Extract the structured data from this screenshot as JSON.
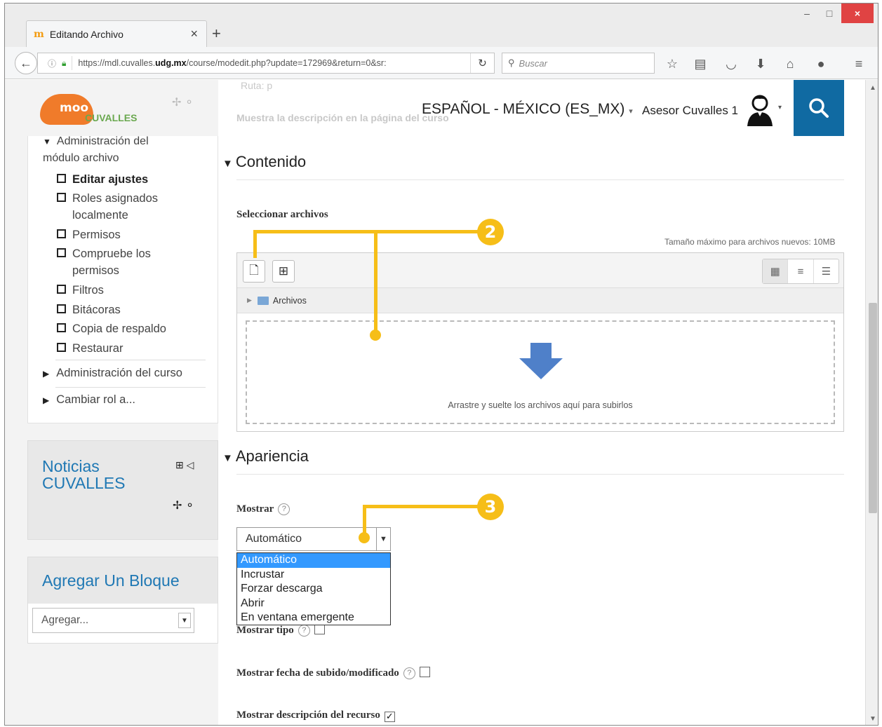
{
  "browser": {
    "tab_title": "Editando Archivo",
    "tab_favicon": "m",
    "tab_close": "×",
    "new_tab": "+",
    "window_controls": {
      "minimize": "–",
      "maximize": "□",
      "close": "×"
    },
    "url_prefix": "https://mdl.cuvalles.",
    "url_domain": "udg.mx",
    "url_path": "/course/modedit.php?update=172969&return=0&sr:",
    "search_placeholder": "Buscar",
    "toolbar_icons": [
      "star-icon",
      "reading-list-icon",
      "pocket-icon",
      "download-icon",
      "home-icon",
      "chat-icon",
      "menu-icon"
    ]
  },
  "header": {
    "logo_text": "moo",
    "logo_brand": "CUVALLES",
    "language": "ESPAÑOL - MÉXICO (ES_MX)",
    "user_name": "Asesor Cuvalles 1",
    "faded_path_text": "Ruta: p",
    "faded_description_text": "Muestra la descripción en la página del curso"
  },
  "sidebar": {
    "admin_heading": "Administración del módulo archivo",
    "items": [
      {
        "label": "Editar ajustes",
        "bold": true
      },
      {
        "label": "Roles asignados localmente"
      },
      {
        "label": "Permisos"
      },
      {
        "label": "Compruebe los permisos"
      },
      {
        "label": "Filtros"
      },
      {
        "label": "Bitácoras"
      },
      {
        "label": "Copia de respaldo"
      },
      {
        "label": "Restaurar"
      }
    ],
    "course_admin": "Administración del curso",
    "switch_role": "Cambiar rol a..."
  },
  "news_block": {
    "title": "Noticias CUVALLES"
  },
  "add_block": {
    "title": "Agregar Un Bloque",
    "select_value": "Agregar..."
  },
  "content_section": {
    "heading": "Contenido",
    "files_label": "Seleccionar archivos",
    "max_size": "Tamaño máximo para archivos nuevos: 10MB",
    "folder_label": "Archivos",
    "drop_text": "Arrastre y suelte los archivos aquí para subirlos"
  },
  "appearance_section": {
    "heading": "Apariencia",
    "display_label": "Mostrar",
    "display_value": "Automático",
    "display_options": [
      "Automático",
      "Incrustar",
      "Forzar descarga",
      "Abrir",
      "En ventana emergente"
    ],
    "show_type_label": "Mostrar tipo",
    "show_type_checked": false,
    "show_date_label": "Mostrar fecha de subido/modificado",
    "show_date_checked": false,
    "show_description_label": "Mostrar descripción del recurso",
    "show_description_checked": true
  },
  "annotations": {
    "callout_2": "2",
    "callout_3": "3"
  },
  "colors": {
    "accent_blue": "#106aa2",
    "link_blue": "#1f78b4",
    "callout_yellow": "#f6be18",
    "selected_option": "#3399ff"
  }
}
